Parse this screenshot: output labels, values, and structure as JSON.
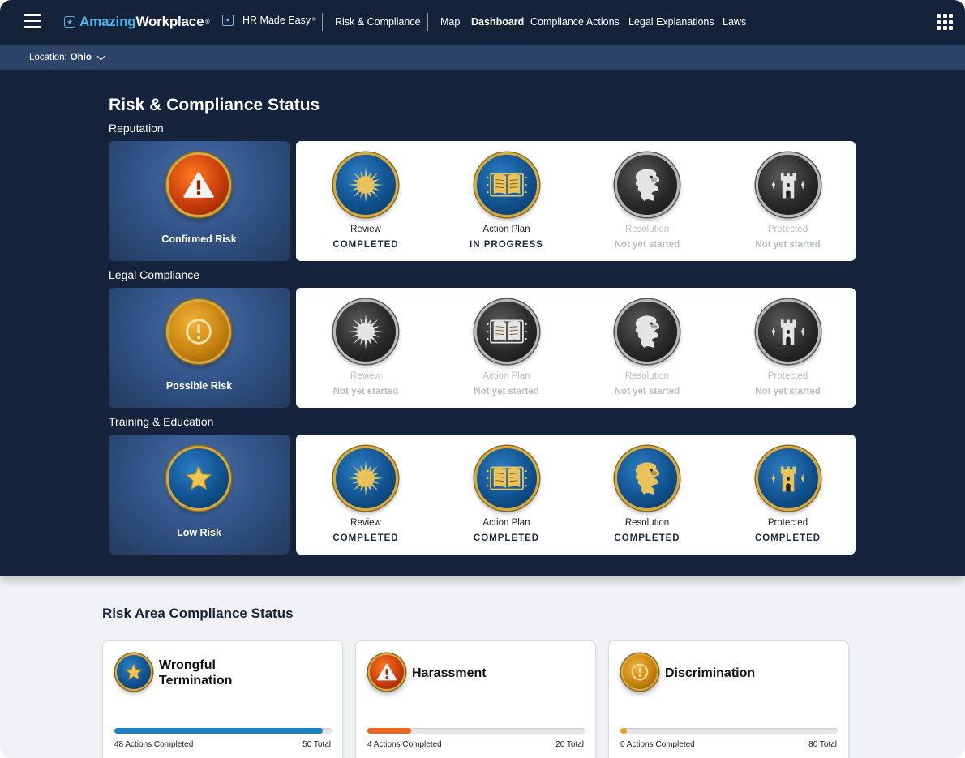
{
  "header": {
    "brand_prefix": "Amazing",
    "brand_suffix": "Workplace",
    "brand_mark": "®",
    "product": "HR Made Easy",
    "product_mark": "®",
    "section": "Risk & Compliance",
    "nav": [
      {
        "label": "Map",
        "active": false
      },
      {
        "label": "Dashboard",
        "active": true
      },
      {
        "label": "Compliance Actions",
        "active": false
      },
      {
        "label": "Legal Explanations",
        "active": false
      },
      {
        "label": "Laws",
        "active": false
      }
    ]
  },
  "location": {
    "prefix": "Location:",
    "value": "Ohio"
  },
  "status": {
    "title": "Risk & Compliance Status",
    "rows": [
      {
        "label": "Reputation",
        "risk": {
          "label": "Confirmed Risk",
          "icon": "warning-triangle-icon",
          "color": "#c83d0c"
        },
        "stages": [
          {
            "name": "Review",
            "status": "COMPLETED",
            "icon": "sun-icon",
            "state": "active"
          },
          {
            "name": "Action Plan",
            "status": "IN PROGRESS",
            "icon": "book-icon",
            "state": "active"
          },
          {
            "name": "Resolution",
            "status": "Not yet started",
            "icon": "lion-icon",
            "state": "inactive"
          },
          {
            "name": "Protected",
            "status": "Not yet started",
            "icon": "castle-icon",
            "state": "inactive"
          }
        ]
      },
      {
        "label": "Legal Compliance",
        "risk": {
          "label": "Possible Risk",
          "icon": "exclamation-circle-icon",
          "color": "#c88410"
        },
        "stages": [
          {
            "name": "Review",
            "status": "Not yet started",
            "icon": "sun-icon",
            "state": "inactive"
          },
          {
            "name": "Action Plan",
            "status": "Not yet started",
            "icon": "book-icon",
            "state": "inactive"
          },
          {
            "name": "Resolution",
            "status": "Not yet started",
            "icon": "lion-icon",
            "state": "inactive"
          },
          {
            "name": "Protected",
            "status": "Not yet started",
            "icon": "castle-icon",
            "state": "inactive"
          }
        ]
      },
      {
        "label": "Training & Education",
        "risk": {
          "label": "Low Risk",
          "icon": "star-icon",
          "color": "#11528f"
        },
        "stages": [
          {
            "name": "Review",
            "status": "COMPLETED",
            "icon": "sun-icon",
            "state": "active"
          },
          {
            "name": "Action Plan",
            "status": "COMPLETED",
            "icon": "book-icon",
            "state": "active"
          },
          {
            "name": "Resolution",
            "status": "COMPLETED",
            "icon": "lion-icon",
            "state": "active"
          },
          {
            "name": "Protected",
            "status": "COMPLETED",
            "icon": "castle-icon",
            "state": "active"
          }
        ]
      }
    ]
  },
  "areas": {
    "title": "Risk Area Compliance Status",
    "cards": [
      {
        "title_line1": "Wrongful",
        "title_line2": "Termination",
        "icon": "star-icon",
        "completed": 48,
        "total": 50,
        "done_label": "48 Actions Completed",
        "total_label": "50 Total",
        "bar_color": "#1684c7"
      },
      {
        "title_line1": "Harassment",
        "title_line2": "",
        "icon": "warning-triangle-icon",
        "completed": 4,
        "total": 20,
        "done_label": "4 Actions Completed",
        "total_label": "20 Total",
        "bar_color": "#f0661a"
      },
      {
        "title_line1": "Discrimination",
        "title_line2": "",
        "icon": "exclamation-circle-icon",
        "completed": 0,
        "total": 80,
        "done_label": "0 Actions Completed",
        "total_label": "80 Total",
        "bar_color": "#f0a014"
      }
    ]
  }
}
